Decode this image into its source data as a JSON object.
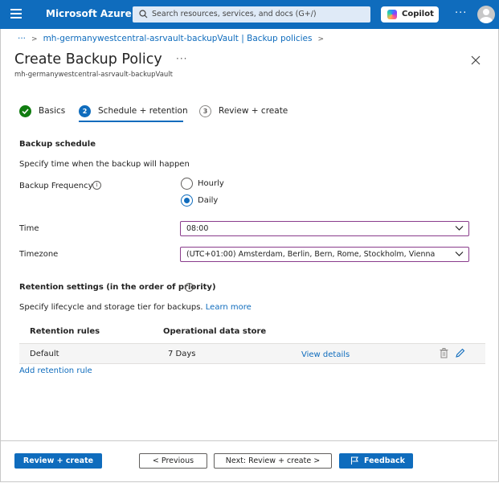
{
  "topbar": {
    "brand": "Microsoft Azure",
    "search_placeholder": "Search resources, services, and docs (G+/)",
    "copilot_label": "Copilot",
    "more_label": "···"
  },
  "breadcrumb": {
    "more": "···",
    "item": "mh-germanywestcentral-asrvault-backupVault | Backup policies"
  },
  "header": {
    "title": "Create Backup Policy",
    "more": "···",
    "subtitle": "mh-germanywestcentral-asrvault-backupVault"
  },
  "steps": [
    {
      "label": "Basics",
      "state": "complete"
    },
    {
      "label": "Schedule + retention",
      "number": "2",
      "state": "active"
    },
    {
      "label": "Review + create",
      "number": "3",
      "state": "inactive"
    }
  ],
  "schedule": {
    "section_title": "Backup schedule",
    "description": "Specify time when the backup will happen",
    "frequency_label": "Backup Frequency",
    "options": [
      {
        "label": "Hourly",
        "selected": false
      },
      {
        "label": "Daily",
        "selected": true
      }
    ],
    "time_label": "Time",
    "time_value": "08:00",
    "timezone_label": "Timezone",
    "timezone_value": "(UTC+01:00) Amsterdam, Berlin, Bern, Rome, Stockholm, Vienna"
  },
  "retention": {
    "section_title": "Retention settings (in the order of priority)",
    "description": "Specify lifecycle and storage tier for backups.",
    "learn_more": "Learn more",
    "columns": [
      "Retention rules",
      "Operational data store"
    ],
    "rows": [
      {
        "rule": "Default",
        "store": "7 Days",
        "action": "View details"
      }
    ],
    "add_rule": "Add retention rule"
  },
  "footer": {
    "review_create": "Review + create",
    "previous": "< Previous",
    "next": "Next: Review + create >",
    "feedback": "Feedback"
  },
  "colors": {
    "accent": "#0f6cbd",
    "success": "#107c10",
    "select_border": "#8a3c8c"
  }
}
